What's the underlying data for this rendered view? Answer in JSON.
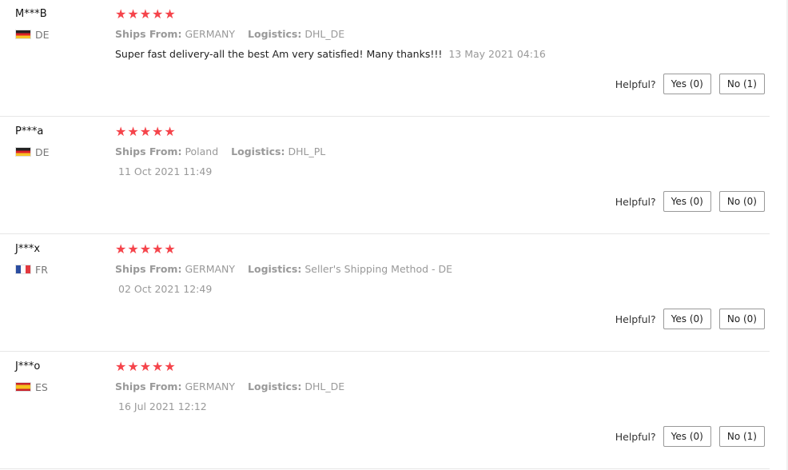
{
  "reviews": [
    {
      "user": "M***B",
      "country_code": "DE",
      "flag_icon": "germany-flag-icon",
      "rating": 5,
      "stars": "★★★★★",
      "ships_from_label": "Ships From:",
      "ships_from": "GERMANY",
      "logistics_label": "Logistics:",
      "logistics": "DHL_DE",
      "text": "Super fast delivery-all the best Am very satisfied! Many thanks!!!",
      "date": "13 May 2021 04:16",
      "helpful_label": "Helpful?",
      "yes_label": "Yes (0)",
      "no_label": "No (1)"
    },
    {
      "user": "P***a",
      "country_code": "DE",
      "flag_icon": "germany-flag-icon",
      "rating": 5,
      "stars": "★★★★★",
      "ships_from_label": "Ships From:",
      "ships_from": "Poland",
      "logistics_label": "Logistics:",
      "logistics": "DHL_PL",
      "text": "",
      "date": "11 Oct 2021 11:49",
      "helpful_label": "Helpful?",
      "yes_label": "Yes (0)",
      "no_label": "No (0)"
    },
    {
      "user": "J***x",
      "country_code": "FR",
      "flag_icon": "france-flag-icon",
      "rating": 5,
      "stars": "★★★★★",
      "ships_from_label": "Ships From:",
      "ships_from": "GERMANY",
      "logistics_label": "Logistics:",
      "logistics": "Seller's Shipping Method - DE",
      "text": "",
      "date": "02 Oct 2021 12:49",
      "helpful_label": "Helpful?",
      "yes_label": "Yes (0)",
      "no_label": "No (0)"
    },
    {
      "user": "J***o",
      "country_code": "ES",
      "flag_icon": "spain-flag-icon",
      "rating": 5,
      "stars": "★★★★★",
      "ships_from_label": "Ships From:",
      "ships_from": "GERMANY",
      "logistics_label": "Logistics:",
      "logistics": "DHL_DE",
      "text": "",
      "date": "16 Jul 2021 12:12",
      "helpful_label": "Helpful?",
      "yes_label": "Yes (0)",
      "no_label": "No (1)"
    }
  ],
  "colors": {
    "star": "#f5444b",
    "muted_text": "#999999",
    "divider": "#e6e6e6"
  }
}
